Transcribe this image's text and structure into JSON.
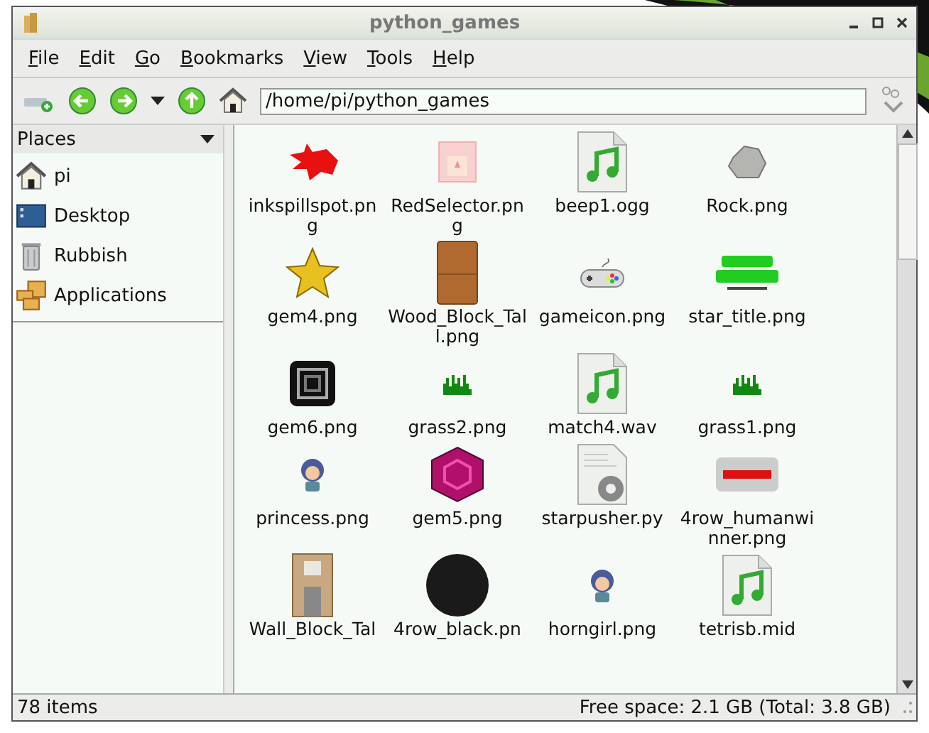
{
  "window": {
    "title": "python_games"
  },
  "menu": [
    "File",
    "Edit",
    "Go",
    "Bookmarks",
    "View",
    "Tools",
    "Help"
  ],
  "location": "/home/pi/python_games",
  "sidebar": {
    "title": "Places",
    "items": [
      {
        "label": "pi",
        "kind": "home"
      },
      {
        "label": "Desktop",
        "kind": "desktop"
      },
      {
        "label": "Rubbish",
        "kind": "trash"
      },
      {
        "label": "Applications",
        "kind": "apps"
      }
    ]
  },
  "files": [
    {
      "name": "inkspillspot.png",
      "kind": "splat"
    },
    {
      "name": "RedSelector.png",
      "kind": "selector"
    },
    {
      "name": "beep1.ogg",
      "kind": "audio"
    },
    {
      "name": "Rock.png",
      "kind": "rock"
    },
    {
      "name": "gem4.png",
      "kind": "star"
    },
    {
      "name": "Wood_Block_Tall.png",
      "kind": "wood"
    },
    {
      "name": "gameicon.png",
      "kind": "gamepad"
    },
    {
      "name": "star_title.png",
      "kind": "title"
    },
    {
      "name": "gem6.png",
      "kind": "darkgem"
    },
    {
      "name": "grass2.png",
      "kind": "grass"
    },
    {
      "name": "match4.wav",
      "kind": "audio"
    },
    {
      "name": "grass1.png",
      "kind": "grass"
    },
    {
      "name": "princess.png",
      "kind": "character"
    },
    {
      "name": "gem5.png",
      "kind": "gem"
    },
    {
      "name": "starpusher.py",
      "kind": "script"
    },
    {
      "name": "4row_humanwinner.png",
      "kind": "badge"
    },
    {
      "name": "Wall_Block_Tal",
      "kind": "wall"
    },
    {
      "name": "4row_black.pn",
      "kind": "ball"
    },
    {
      "name": "horngirl.png",
      "kind": "character"
    },
    {
      "name": "tetrisb.mid",
      "kind": "audio"
    }
  ],
  "status_bar": {
    "count": "78 items",
    "free_space": "Free space: 2.1 GB (Total: 3.8 GB)"
  }
}
